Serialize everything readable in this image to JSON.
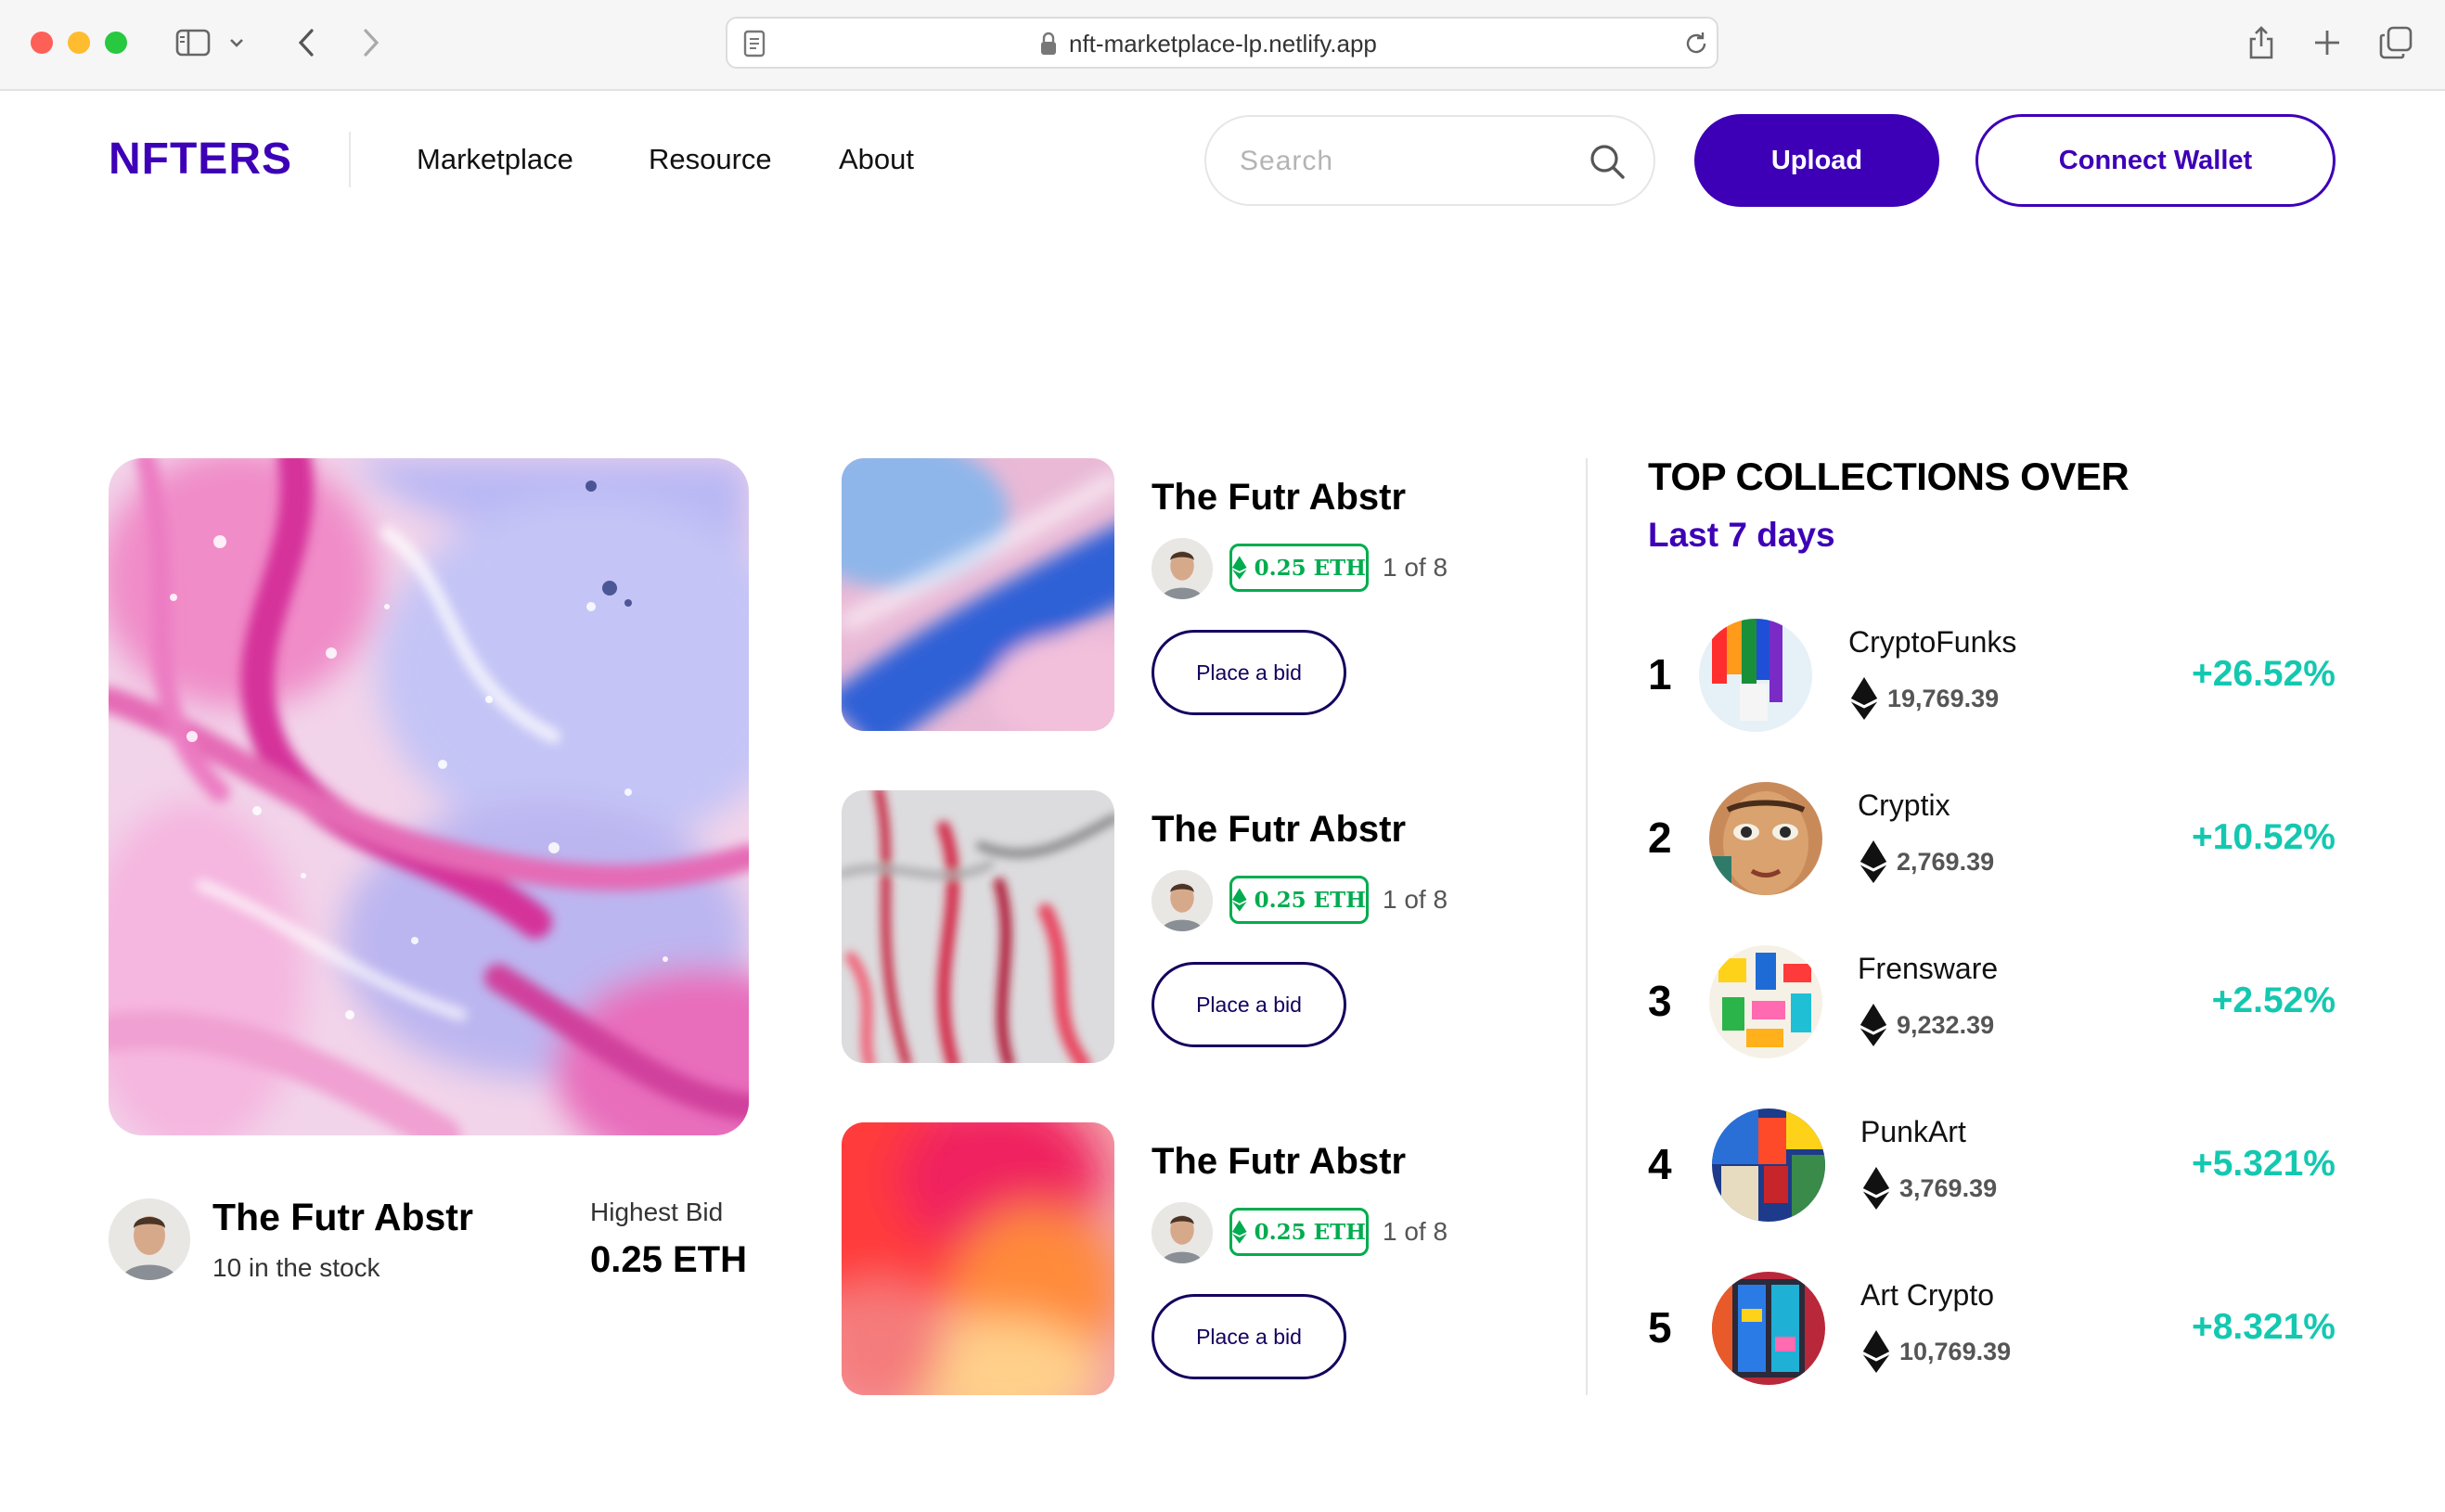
{
  "browser": {
    "url": "nft-marketplace-lp.netlify.app"
  },
  "header": {
    "logo": "NFTERS",
    "nav": [
      {
        "label": "Marketplace"
      },
      {
        "label": "Resource"
      },
      {
        "label": "About"
      }
    ],
    "search_placeholder": "Search",
    "upload_label": "Upload",
    "wallet_label": "Connect Wallet"
  },
  "hero": {
    "title": "The Futr Abstr",
    "stock": "10 in the stock",
    "highest_bid_label": "Highest Bid",
    "highest_bid_value": "0.25 ETH"
  },
  "cards": [
    {
      "title": "The Futr Abstr",
      "price": "0.25 ETH",
      "edition": "1 of 8",
      "bid_label": "Place a bid"
    },
    {
      "title": "The Futr Abstr",
      "price": "0.25 ETH",
      "edition": "1 of 8",
      "bid_label": "Place a bid"
    },
    {
      "title": "The Futr Abstr",
      "price": "0.25 ETH",
      "edition": "1 of 8",
      "bid_label": "Place a bid"
    }
  ],
  "collections": {
    "title": "TOP COLLECTIONS OVER",
    "period": "Last 7 days",
    "items": [
      {
        "rank": "1",
        "name": "CryptoFunks",
        "value": "19,769.39",
        "change": "+26.52%"
      },
      {
        "rank": "2",
        "name": "Cryptix",
        "value": "2,769.39",
        "change": "+10.52%"
      },
      {
        "rank": "3",
        "name": "Frensware",
        "value": "9,232.39",
        "change": "+2.52%"
      },
      {
        "rank": "4",
        "name": "PunkArt",
        "value": "3,769.39",
        "change": "+5.321%"
      },
      {
        "rank": "5",
        "name": "Art Crypto",
        "value": "10,769.39",
        "change": "+8.321%"
      }
    ]
  },
  "colors": {
    "brand": "#3d00b7",
    "positive": "#14c8b0",
    "eth_green": "#00ac4f"
  }
}
